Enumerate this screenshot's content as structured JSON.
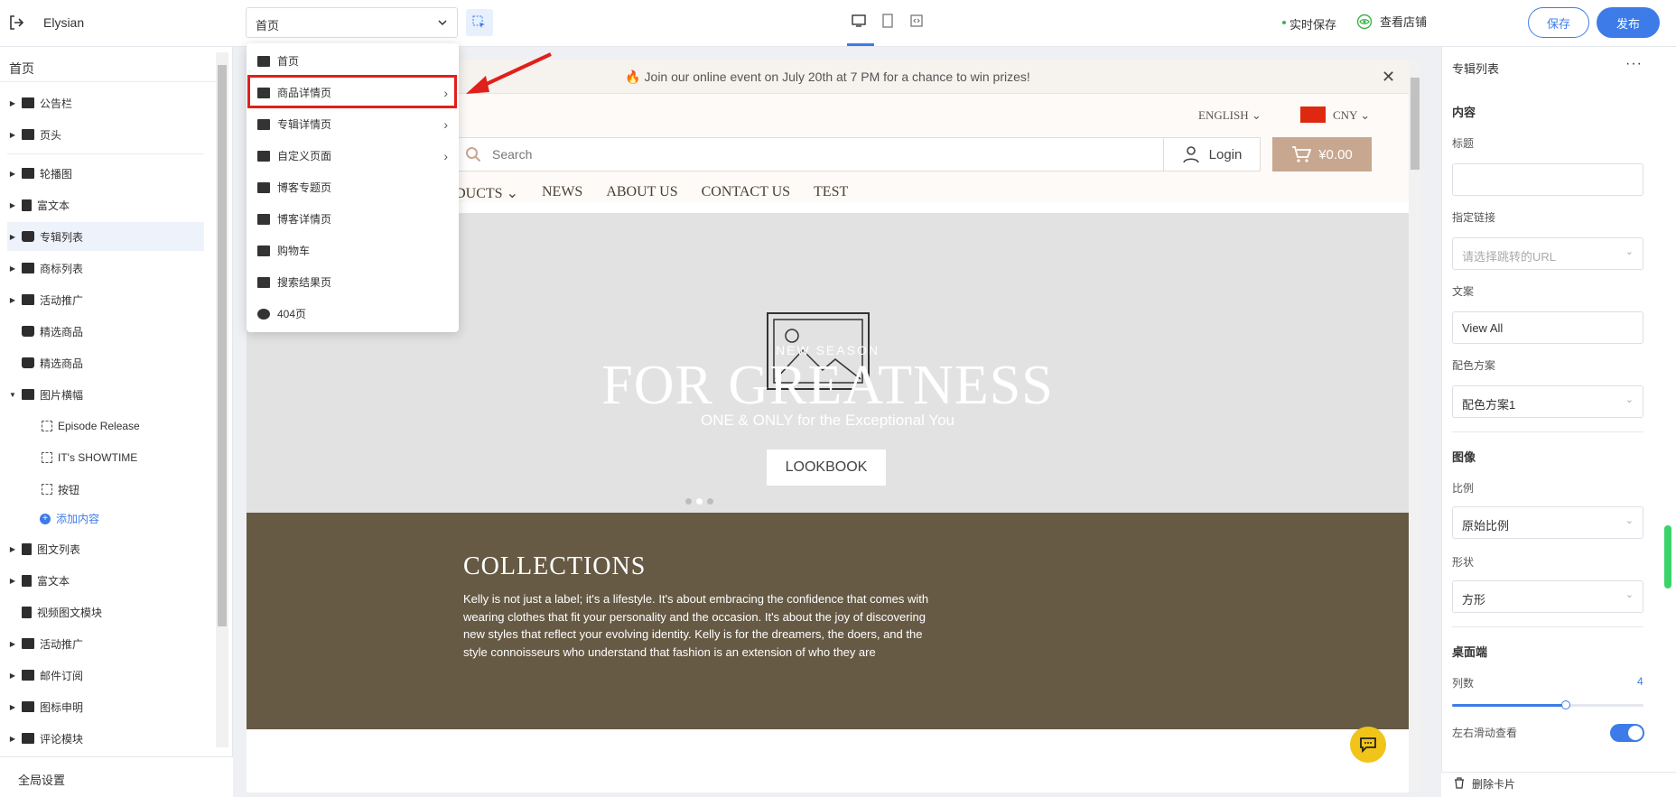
{
  "app": {
    "store_name": "Elysian",
    "autosave": "实时保存",
    "view_store": "查看店铺",
    "save": "保存",
    "publish": "发布"
  },
  "page_select": {
    "value": "首页"
  },
  "dropdown": {
    "items": [
      {
        "label": "首页",
        "has_submenu": false
      },
      {
        "label": "商品详情页",
        "has_submenu": true
      },
      {
        "label": "专辑详情页",
        "has_submenu": true
      },
      {
        "label": "自定义页面",
        "has_submenu": true
      },
      {
        "label": "博客专题页",
        "has_submenu": false
      },
      {
        "label": "博客详情页",
        "has_submenu": false
      },
      {
        "label": "购物车",
        "has_submenu": false
      },
      {
        "label": "搜索结果页",
        "has_submenu": false
      },
      {
        "label": "404页",
        "has_submenu": false
      }
    ]
  },
  "left_panel": {
    "title": "首页",
    "items": [
      {
        "label": "公告栏",
        "expandable": true
      },
      {
        "label": "页头",
        "expandable": true
      },
      {
        "label": "轮播图",
        "expandable": true
      },
      {
        "label": "富文本",
        "expandable": true
      },
      {
        "label": "专辑列表",
        "expandable": true,
        "selected": true
      },
      {
        "label": "商标列表",
        "expandable": true
      },
      {
        "label": "活动推广",
        "expandable": true
      },
      {
        "label": "精选商品",
        "expandable": false
      },
      {
        "label": "精选商品",
        "expandable": false
      },
      {
        "label": "图片横幅",
        "expandable": true,
        "expanded": true
      },
      {
        "label": "Episode Release",
        "child": true
      },
      {
        "label": "IT's SHOWTIME",
        "child": true
      },
      {
        "label": "按钮",
        "child": true
      },
      {
        "label": "图文列表",
        "expandable": true
      },
      {
        "label": "富文本",
        "expandable": true
      },
      {
        "label": "视频图文模块",
        "expandable": false
      },
      {
        "label": "活动推广",
        "expandable": true
      },
      {
        "label": "邮件订阅",
        "expandable": true
      },
      {
        "label": "图标申明",
        "expandable": true
      },
      {
        "label": "评论模块",
        "expandable": true
      }
    ],
    "add_content": "添加内容",
    "global_settings": "全局设置"
  },
  "preview": {
    "announcement": "Join our online event on July 20th at 7 PM for a chance to win prizes!",
    "language": "ENGLISH",
    "currency": "CNY",
    "search_placeholder": "Search",
    "login": "Login",
    "cart_total": "¥0.00",
    "nav": [
      "PRODUCTS",
      "NEWS",
      "ABOUT US",
      "CONTACT US",
      "TEST"
    ],
    "hero": {
      "eyebrow": "NEW SEASON",
      "title": "FOR GREATNESS",
      "subtitle": "ONE & ONLY for the Exceptional You",
      "button": "LOOKBOOK"
    },
    "collections": {
      "title": "COLLECTIONS",
      "text": "Kelly is not just a label; it's a lifestyle. It's about embracing the confidence that comes with wearing clothes that fit your personality and the occasion. It's about the joy of discovering new styles that reflect your evolving identity. Kelly is for the dreamers, the doers, and the style connoisseurs who understand that fashion is an extension of who they are"
    }
  },
  "right_panel": {
    "title": "专辑列表",
    "section_content": "内容",
    "label_title": "标题",
    "title_value": "",
    "label_link": "指定链接",
    "link_placeholder": "请选择跳转的URL",
    "label_copy": "文案",
    "copy_value": "View All",
    "label_color": "配色方案",
    "color_value": "配色方案1",
    "section_image": "图像",
    "label_ratio": "比例",
    "ratio_value": "原始比例",
    "label_shape": "形状",
    "shape_value": "方形",
    "section_desktop": "桌面端",
    "label_columns": "列数",
    "columns_value": "4",
    "label_swipe": "左右滑动查看",
    "delete_card": "删除卡片"
  }
}
